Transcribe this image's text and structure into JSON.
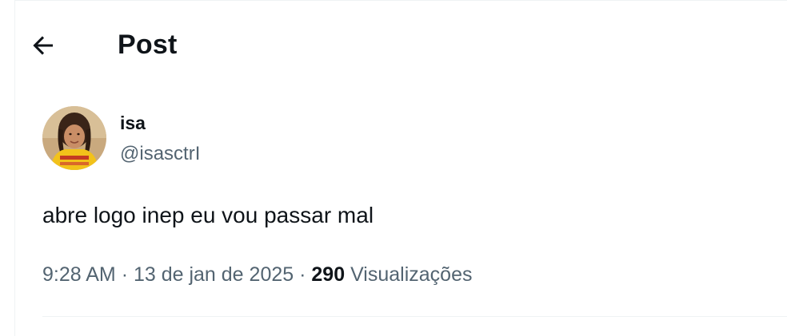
{
  "header": {
    "title": "Post",
    "back_icon": "arrow-left-icon"
  },
  "author": {
    "display_name": "isa",
    "handle": "@isasctrI",
    "avatar_icon": "profile-photo"
  },
  "post": {
    "text": "abre logo inep eu vou passar mal",
    "time": "9:28 AM",
    "separator": "·",
    "date": "13 de jan de 2025",
    "views_count": "290",
    "views_label": "Visualizações"
  },
  "colors": {
    "text_primary": "#0f1419",
    "text_secondary": "#536471",
    "border": "#eff3f4"
  }
}
